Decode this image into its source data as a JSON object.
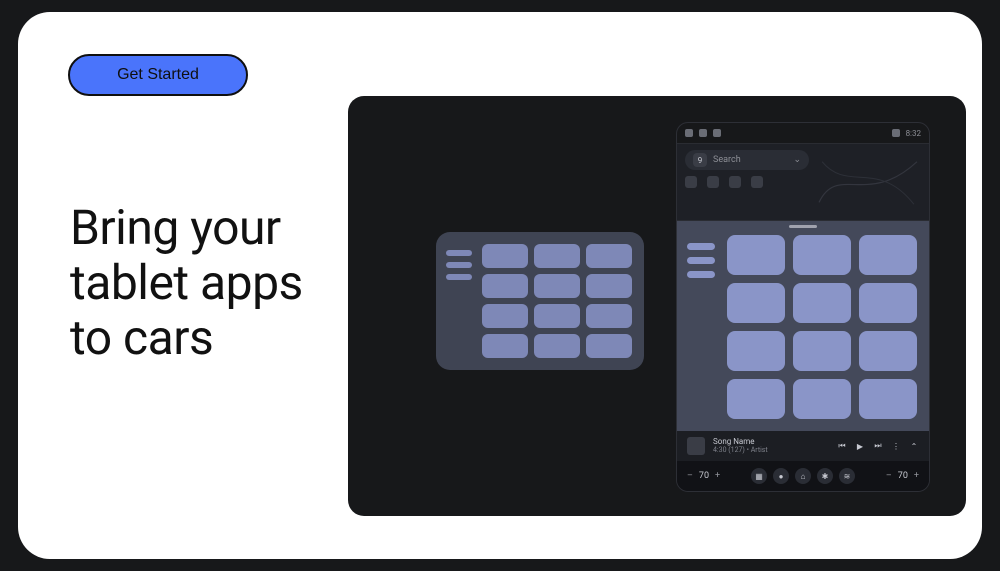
{
  "cta_label": "Get Started",
  "headline": "Bring your\ntablet apps\nto cars",
  "status": {
    "time": "8:32",
    "signal_icon": "signal-icon"
  },
  "map": {
    "search_badge": "9",
    "search_placeholder": "Search"
  },
  "now_playing": {
    "title": "Song Name",
    "subtitle": "4:30 (127) • Artist"
  },
  "climate": {
    "left_temp": "70",
    "right_temp": "70"
  }
}
